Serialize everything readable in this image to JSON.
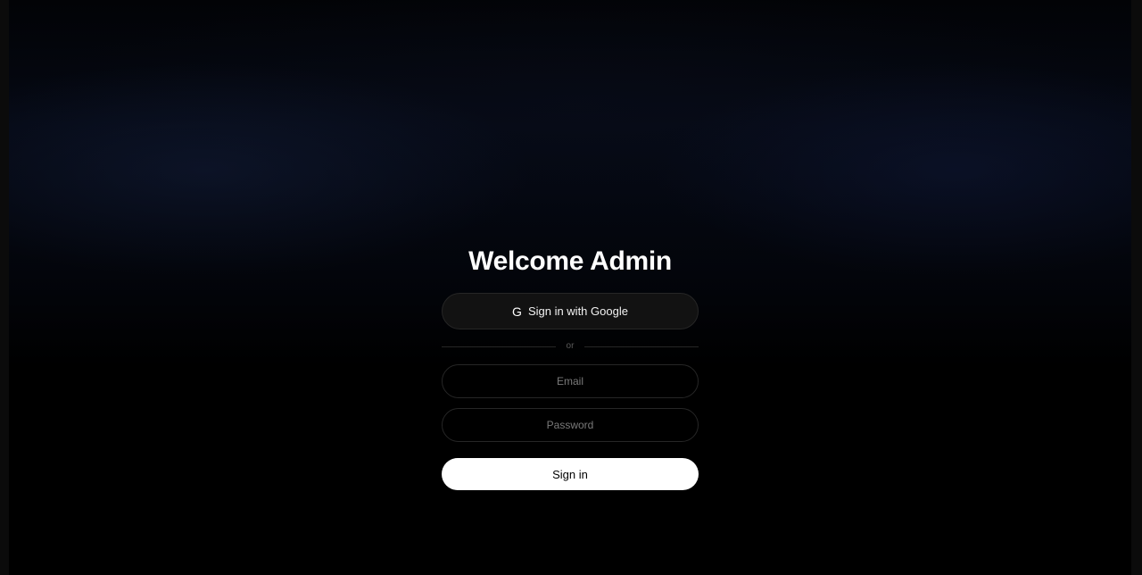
{
  "login": {
    "title": "Welcome Admin",
    "google_button": {
      "icon": "G",
      "label": "Sign in with Google"
    },
    "divider_label": "or",
    "email": {
      "placeholder": "Email",
      "value": ""
    },
    "password": {
      "placeholder": "Password",
      "value": ""
    },
    "submit_label": "Sign in"
  },
  "colors": {
    "background": "#000000",
    "title_text": "#ffffff",
    "google_button_bg": "#121212",
    "field_border": "#262626",
    "submit_bg": "#ffffff",
    "submit_text": "#000000",
    "placeholder_text": "#7a7a7a"
  }
}
